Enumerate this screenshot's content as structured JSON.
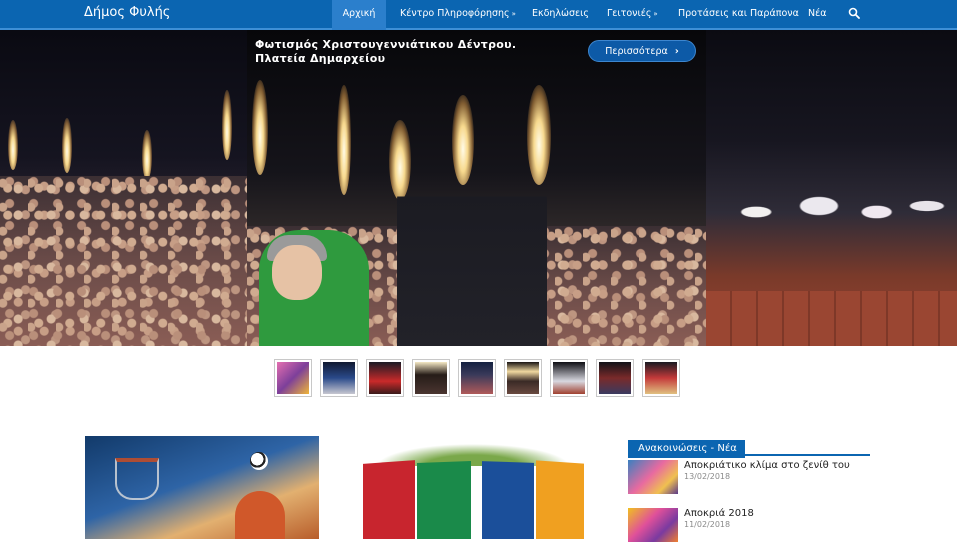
{
  "header": {
    "brand": "Δήμος Φυλής",
    "nav": [
      {
        "label": "Αρχική",
        "active": true,
        "dropdown": false
      },
      {
        "label": "Κέντρο Πληροφόρησης",
        "active": false,
        "dropdown": true
      },
      {
        "label": "Εκδηλώσεις",
        "active": false,
        "dropdown": false
      },
      {
        "label": "Γειτονιές",
        "active": false,
        "dropdown": true
      },
      {
        "label": "Προτάσεις και Παράπονα",
        "active": false,
        "dropdown": false
      },
      {
        "label": "Νέα",
        "active": false,
        "dropdown": false
      }
    ],
    "search_icon": "search-icon",
    "dropdown_icon": "»",
    "colors": {
      "bar": "#0b65b1",
      "active": "#2b7fcc"
    }
  },
  "slider": {
    "caption_line1": "Φωτισμός Χριστουγεννιάτικου Δέντρου.",
    "caption_line2": "Πλατεία Δημαρχείου",
    "more_label": "Περισσότερα",
    "more_icon": "›",
    "thumbnail_count": 9
  },
  "sidebar": {
    "title": "Ανακοινώσεις - Νέα",
    "items": [
      {
        "title": "Αποκριάτικο κλίμα στο ζενίθ του",
        "date": "13/02/2018"
      },
      {
        "title": "Αποκριά 2018",
        "date": "11/02/2018"
      }
    ]
  }
}
